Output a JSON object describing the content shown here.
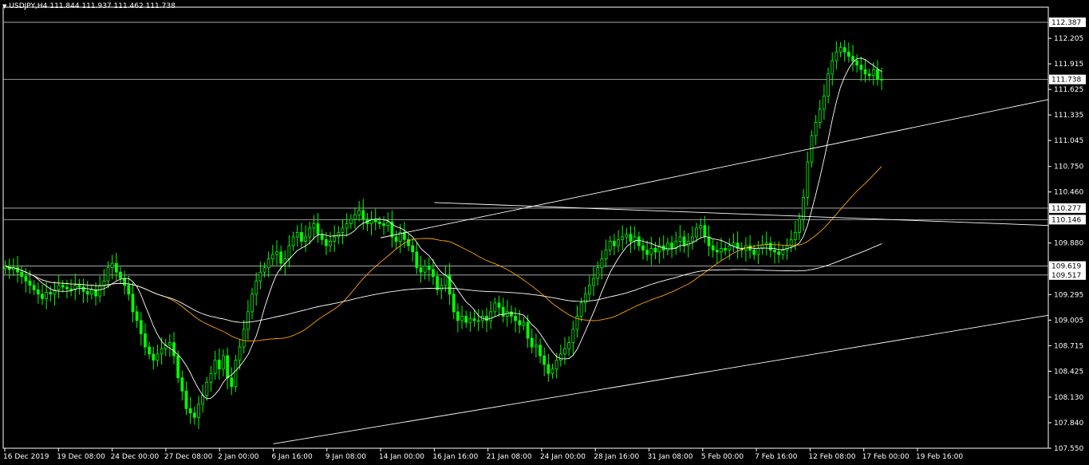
{
  "header": {
    "symbol_timeframe": "USDJPY,H4",
    "ohlc": "111.844 111.937 111.462 111.738"
  },
  "colors": {
    "background": "#000000",
    "bull_candle": "#00ff00",
    "bear_candle": "#00ff00",
    "horizontal_line": "#c0c0c0",
    "trend_line": "#ffffff",
    "ma_fast": "#ffffff",
    "ma_mid": "#ffa500",
    "ma_slow": "#ffffff",
    "axis": "#ffffff",
    "price_label_bg": "#ffffff",
    "price_label_text": "#000000"
  },
  "chart_data": {
    "type": "candlestick",
    "symbol": "USDJPY",
    "timeframe": "H4",
    "ylim": [
      107.55,
      112.45
    ],
    "y_ticks": [
      "112.205",
      "111.915",
      "111.625",
      "111.335",
      "111.045",
      "110.750",
      "110.460",
      "109.880",
      "109.295",
      "109.005",
      "108.715",
      "108.425",
      "108.130",
      "107.840",
      "107.550"
    ],
    "x_ticks": [
      "16 Dec 2019",
      "19 Dec 08:00",
      "24 Dec 00:00",
      "27 Dec 08:00",
      "2 Jan 00:00",
      "6 Jan 16:00",
      "9 Jan 08:00",
      "14 Jan 00:00",
      "16 Jan 16:00",
      "21 Jan 08:00",
      "24 Jan 00:00",
      "28 Jan 16:00",
      "31 Jan 08:00",
      "5 Feb 00:00",
      "7 Feb 16:00",
      "12 Feb 08:00",
      "17 Feb 00:00",
      "19 Feb 16:00"
    ],
    "horizontal_lines": [
      {
        "label": "112.387",
        "value": 112.387
      },
      {
        "label": "111.738",
        "value": 111.738
      },
      {
        "label": "110.277",
        "value": 110.277
      },
      {
        "label": "110.146",
        "value": 110.146
      },
      {
        "label": "109.619",
        "value": 109.619
      },
      {
        "label": "109.517",
        "value": 109.517
      }
    ],
    "bars_count": 222,
    "closes": [
      109.62,
      109.58,
      109.6,
      109.55,
      109.5,
      109.45,
      109.4,
      109.35,
      109.3,
      109.25,
      109.32,
      109.3,
      109.35,
      109.4,
      109.38,
      109.36,
      109.35,
      109.4,
      109.38,
      109.33,
      109.3,
      109.35,
      109.28,
      109.4,
      109.45,
      109.6,
      109.65,
      109.55,
      109.48,
      109.4,
      109.3,
      109.1,
      109.0,
      108.85,
      108.7,
      108.62,
      108.55,
      108.62,
      108.68,
      108.72,
      108.75,
      108.6,
      108.35,
      108.2,
      108.0,
      107.95,
      107.9,
      108.05,
      108.15,
      108.3,
      108.4,
      108.55,
      108.45,
      108.6,
      108.35,
      108.25,
      108.55,
      108.7,
      108.9,
      109.1,
      109.3,
      109.45,
      109.55,
      109.6,
      109.7,
      109.75,
      109.78,
      109.65,
      109.7,
      109.85,
      109.95,
      110.0,
      109.9,
      109.95,
      110.05,
      110.1,
      109.98,
      109.92,
      109.85,
      109.9,
      109.95,
      110.0,
      110.05,
      110.1,
      110.15,
      110.2,
      110.25,
      110.15,
      110.1,
      110.15,
      110.12,
      110.1,
      110.08,
      110.12,
      109.95,
      109.9,
      110.0,
      109.92,
      109.85,
      109.78,
      109.6,
      109.55,
      109.62,
      109.58,
      109.5,
      109.35,
      109.4,
      109.52,
      109.3,
      109.1,
      109.0,
      109.05,
      108.98,
      109.02,
      109.0,
      109.0,
      109.05,
      109.0,
      109.1,
      109.2,
      109.15,
      109.05,
      109.1,
      109.05,
      109.0,
      108.95,
      108.98,
      108.8,
      108.7,
      108.72,
      108.6,
      108.5,
      108.4,
      108.45,
      108.55,
      108.62,
      108.68,
      108.75,
      108.9,
      109.05,
      109.2,
      109.3,
      109.4,
      109.48,
      109.6,
      109.7,
      109.8,
      109.9,
      109.85,
      109.92,
      109.95,
      109.98,
      109.9,
      109.95,
      109.85,
      109.8,
      109.75,
      109.82,
      109.78,
      109.85,
      109.8,
      109.88,
      109.82,
      109.9,
      109.95,
      109.85,
      109.9,
      109.95,
      110.05,
      110.08,
      109.95,
      109.85,
      109.8,
      109.78,
      109.82,
      109.8,
      109.85,
      109.88,
      109.82,
      109.8,
      109.85,
      109.8,
      109.75,
      109.82,
      109.86,
      109.88,
      109.8,
      109.78,
      109.75,
      109.8,
      109.85,
      109.92,
      110.0,
      110.15,
      110.4,
      110.8,
      111.1,
      111.25,
      111.4,
      111.55,
      111.8,
      111.95,
      112.05,
      112.1,
      112.05,
      112.0,
      111.95,
      111.9,
      111.85,
      111.8,
      111.78,
      111.85,
      111.74,
      111.738
    ],
    "trend_lines": [
      {
        "from": [
          "14 Jan 00:00",
          109.94
        ],
        "to": [
          "end",
          111.51
        ]
      },
      {
        "from": [
          "16 Jan 16:00",
          110.34
        ],
        "to": [
          "end",
          110.08
        ]
      },
      {
        "from": [
          "6 Jan 16:00",
          107.6
        ],
        "to": [
          "end",
          109.06
        ]
      }
    ]
  }
}
